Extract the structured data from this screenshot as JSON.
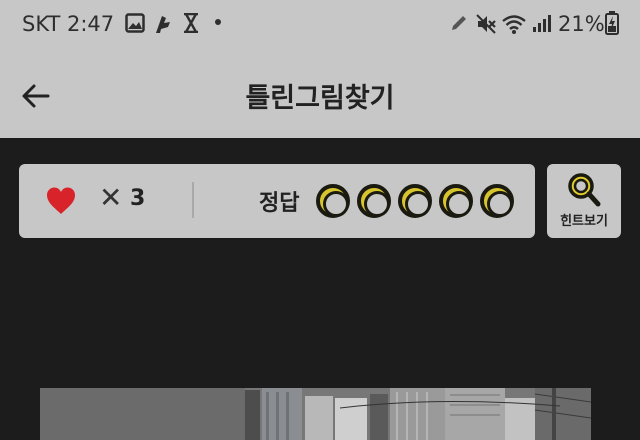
{
  "status_bar": {
    "time": "SKT 2:47",
    "battery": "21%",
    "icons": [
      "image-icon",
      "app-notification-icon",
      "hourglass-icon",
      "dot-icon",
      "pen-icon",
      "mute-icon",
      "wifi-icon",
      "signal-icon",
      "battery-charging-icon"
    ]
  },
  "header": {
    "title": "틀린그림찾기",
    "back_icon": "arrow-left-icon"
  },
  "score_panel": {
    "lives_icon": "heart-icon",
    "times": "✕",
    "lives": "3",
    "answer_label": "정답",
    "answer_slots": [
      {
        "found": false
      },
      {
        "found": false
      },
      {
        "found": false
      },
      {
        "found": false
      },
      {
        "found": false
      }
    ]
  },
  "hint": {
    "label": "힌트보기",
    "icon": "magnifier-icon"
  },
  "colors": {
    "panel_bg": "#c7c7c7",
    "page_bg": "#1c1c1c",
    "heart": "#d8232a",
    "slot_fill": "#d8c52e"
  }
}
